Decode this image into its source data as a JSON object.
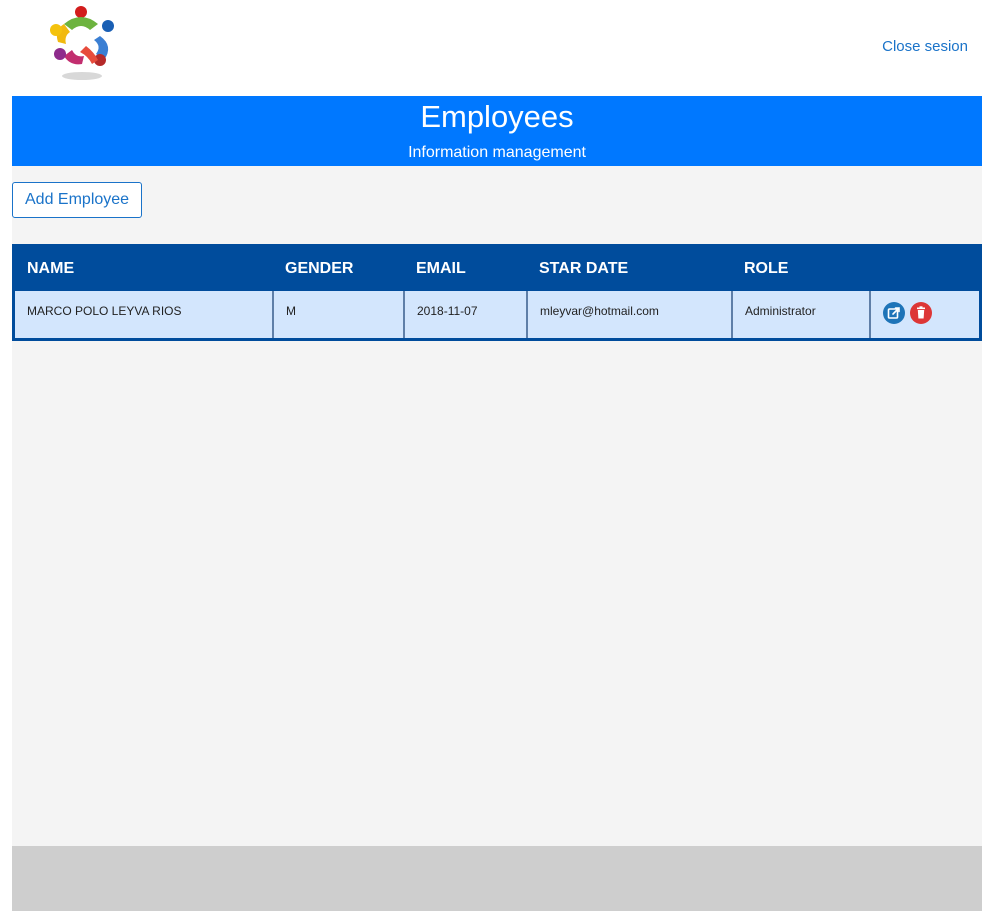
{
  "header": {
    "logo_icon": "team-circle-logo",
    "close_session_label": "Close sesion"
  },
  "hero": {
    "title": "Employees",
    "subtitle": "Information management",
    "bg_color": "#0078ff"
  },
  "actions": {
    "add_label": "Add Employee"
  },
  "table": {
    "headers": [
      "NAME",
      "GENDER",
      "EMAIL",
      "STAR DATE",
      "ROLE",
      ""
    ],
    "rows": [
      {
        "name": "MARCO POLO LEYVA RIOS",
        "gender": "M",
        "start_date": "2018-11-07",
        "email": "mleyvar@hotmail.com",
        "role": "Administrator",
        "actions": [
          "edit-icon",
          "delete-icon"
        ]
      }
    ],
    "header_color": "#004c9c",
    "row_color": "#d3e6fd"
  },
  "colors": {
    "edit": "#1e74b8",
    "delete": "#dd3636",
    "footer": "#cecece"
  }
}
